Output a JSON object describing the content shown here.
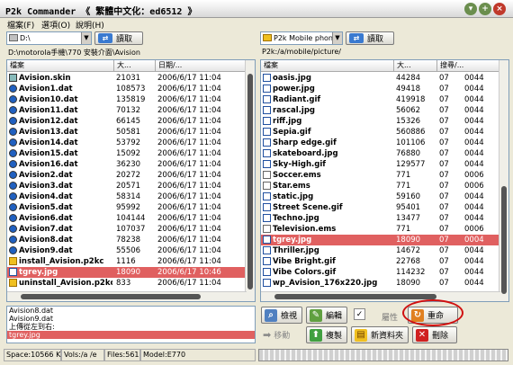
{
  "window": {
    "title": "P2k Commander 《 繁體中文化：ed6512 》"
  },
  "menu": {
    "file": "檔案(F)",
    "options": "選項(O)",
    "help": "說明(H)"
  },
  "left": {
    "drive": "D:\\",
    "read_label": "讀取",
    "path": "D:\\motorola手機\\770 安裝介面\\Avision",
    "headers": {
      "name": "檔案",
      "size": "大...",
      "date": "日期/..."
    },
    "rows": [
      {
        "name": "Avision.skin",
        "size": "21031",
        "date": "2006/6/17 11:04",
        "icon": "skin-file-icon"
      },
      {
        "name": "Avision1.dat",
        "size": "108573",
        "date": "2006/6/17 11:04",
        "icon": "dat-file-icon"
      },
      {
        "name": "Avision10.dat",
        "size": "135819",
        "date": "2006/6/17 11:04",
        "icon": "dat-file-icon"
      },
      {
        "name": "Avision11.dat",
        "size": "70132",
        "date": "2006/6/17 11:04",
        "icon": "dat-file-icon"
      },
      {
        "name": "Avision12.dat",
        "size": "66145",
        "date": "2006/6/17 11:04",
        "icon": "dat-file-icon"
      },
      {
        "name": "Avision13.dat",
        "size": "50581",
        "date": "2006/6/17 11:04",
        "icon": "dat-file-icon"
      },
      {
        "name": "Avision14.dat",
        "size": "53792",
        "date": "2006/6/17 11:04",
        "icon": "dat-file-icon"
      },
      {
        "name": "Avision15.dat",
        "size": "15092",
        "date": "2006/6/17 11:04",
        "icon": "dat-file-icon"
      },
      {
        "name": "Avision16.dat",
        "size": "36230",
        "date": "2006/6/17 11:04",
        "icon": "dat-file-icon"
      },
      {
        "name": "Avision2.dat",
        "size": "20272",
        "date": "2006/6/17 11:04",
        "icon": "dat-file-icon"
      },
      {
        "name": "Avision3.dat",
        "size": "20571",
        "date": "2006/6/17 11:04",
        "icon": "dat-file-icon"
      },
      {
        "name": "Avision4.dat",
        "size": "58314",
        "date": "2006/6/17 11:04",
        "icon": "dat-file-icon"
      },
      {
        "name": "Avision5.dat",
        "size": "95992",
        "date": "2006/6/17 11:04",
        "icon": "dat-file-icon"
      },
      {
        "name": "Avision6.dat",
        "size": "104144",
        "date": "2006/6/17 11:04",
        "icon": "dat-file-icon"
      },
      {
        "name": "Avision7.dat",
        "size": "107037",
        "date": "2006/6/17 11:04",
        "icon": "dat-file-icon"
      },
      {
        "name": "Avision8.dat",
        "size": "78238",
        "date": "2006/6/17 11:04",
        "icon": "dat-file-icon"
      },
      {
        "name": "Avision9.dat",
        "size": "55506",
        "date": "2006/6/17 11:04",
        "icon": "dat-file-icon"
      },
      {
        "name": "install_Avision.p2kc",
        "size": "1116",
        "date": "2006/6/17 11:04",
        "icon": "package-file-icon"
      },
      {
        "name": "tgrey.jpg",
        "size": "18090",
        "date": "2006/6/17 10:46",
        "icon": "image-file-icon",
        "selected": true
      },
      {
        "name": "uninstall_Avision.p2kc",
        "size": "833",
        "date": "2006/6/17 11:04",
        "icon": "package-file-icon"
      }
    ]
  },
  "right": {
    "drive": "P2k Mobile phone",
    "read_label": "讀取",
    "path": "P2k:/a/mobile/picture/",
    "headers": {
      "name": "檔案",
      "size": "大...",
      "attr": "搜尋/..."
    },
    "rows": [
      {
        "name": "oasis.jpg",
        "size": "44284",
        "a": "07",
        "b": "0044",
        "icon": "image-file-icon"
      },
      {
        "name": "power.jpg",
        "size": "49418",
        "a": "07",
        "b": "0044",
        "icon": "image-file-icon"
      },
      {
        "name": "Radiant.gif",
        "size": "419918",
        "a": "07",
        "b": "0044",
        "icon": "image-file-icon"
      },
      {
        "name": "rascal.jpg",
        "size": "56062",
        "a": "07",
        "b": "0044",
        "icon": "image-file-icon"
      },
      {
        "name": "riff.jpg",
        "size": "15326",
        "a": "07",
        "b": "0044",
        "icon": "image-file-icon"
      },
      {
        "name": "Sepia.gif",
        "size": "560886",
        "a": "07",
        "b": "0044",
        "icon": "image-file-icon"
      },
      {
        "name": "Sharp edge.gif",
        "size": "101106",
        "a": "07",
        "b": "0044",
        "icon": "image-file-icon"
      },
      {
        "name": "skateboard.jpg",
        "size": "76880",
        "a": "07",
        "b": "0044",
        "icon": "image-file-icon"
      },
      {
        "name": "Sky-High.gif",
        "size": "129577",
        "a": "07",
        "b": "0044",
        "icon": "image-file-icon"
      },
      {
        "name": "Soccer.ems",
        "size": "771",
        "a": "07",
        "b": "0006",
        "icon": "ems-file-icon"
      },
      {
        "name": "Star.ems",
        "size": "771",
        "a": "07",
        "b": "0006",
        "icon": "ems-file-icon"
      },
      {
        "name": "static.jpg",
        "size": "59160",
        "a": "07",
        "b": "0044",
        "icon": "image-file-icon"
      },
      {
        "name": "Street Scene.gif",
        "size": "95401",
        "a": "07",
        "b": "0044",
        "icon": "image-file-icon"
      },
      {
        "name": "Techno.jpg",
        "size": "13477",
        "a": "07",
        "b": "0044",
        "icon": "image-file-icon"
      },
      {
        "name": "Television.ems",
        "size": "771",
        "a": "07",
        "b": "0006",
        "icon": "ems-file-icon"
      },
      {
        "name": "tgrey.jpg",
        "size": "18090",
        "a": "07",
        "b": "0004",
        "icon": "image-file-icon",
        "selected": true
      },
      {
        "name": "Thriller.jpg",
        "size": "14672",
        "a": "07",
        "b": "0044",
        "icon": "image-file-icon"
      },
      {
        "name": "Vibe Bright.gif",
        "size": "22768",
        "a": "07",
        "b": "0044",
        "icon": "image-file-icon"
      },
      {
        "name": "Vibe Colors.gif",
        "size": "114232",
        "a": "07",
        "b": "0044",
        "icon": "image-file-icon"
      },
      {
        "name": "wp_Avision_176x220.jpg",
        "size": "18090",
        "a": "07",
        "b": "0044",
        "icon": "image-file-icon"
      }
    ]
  },
  "log": [
    "Avision8.dat",
    "Avision9.dat",
    "上傳從左到右:",
    "tgrey.jpg"
  ],
  "actions": {
    "view": "檢視",
    "edit": "編輯",
    "attr": "屬性",
    "rename": "重命",
    "move": "移動",
    "copy": "複製",
    "newfolder": "新資料夾",
    "delete": "刪除"
  },
  "status": {
    "space": "Space:10566 Kb",
    "vols": "Vols:/a /e",
    "files": "Files:561",
    "model": "Model:E770"
  }
}
